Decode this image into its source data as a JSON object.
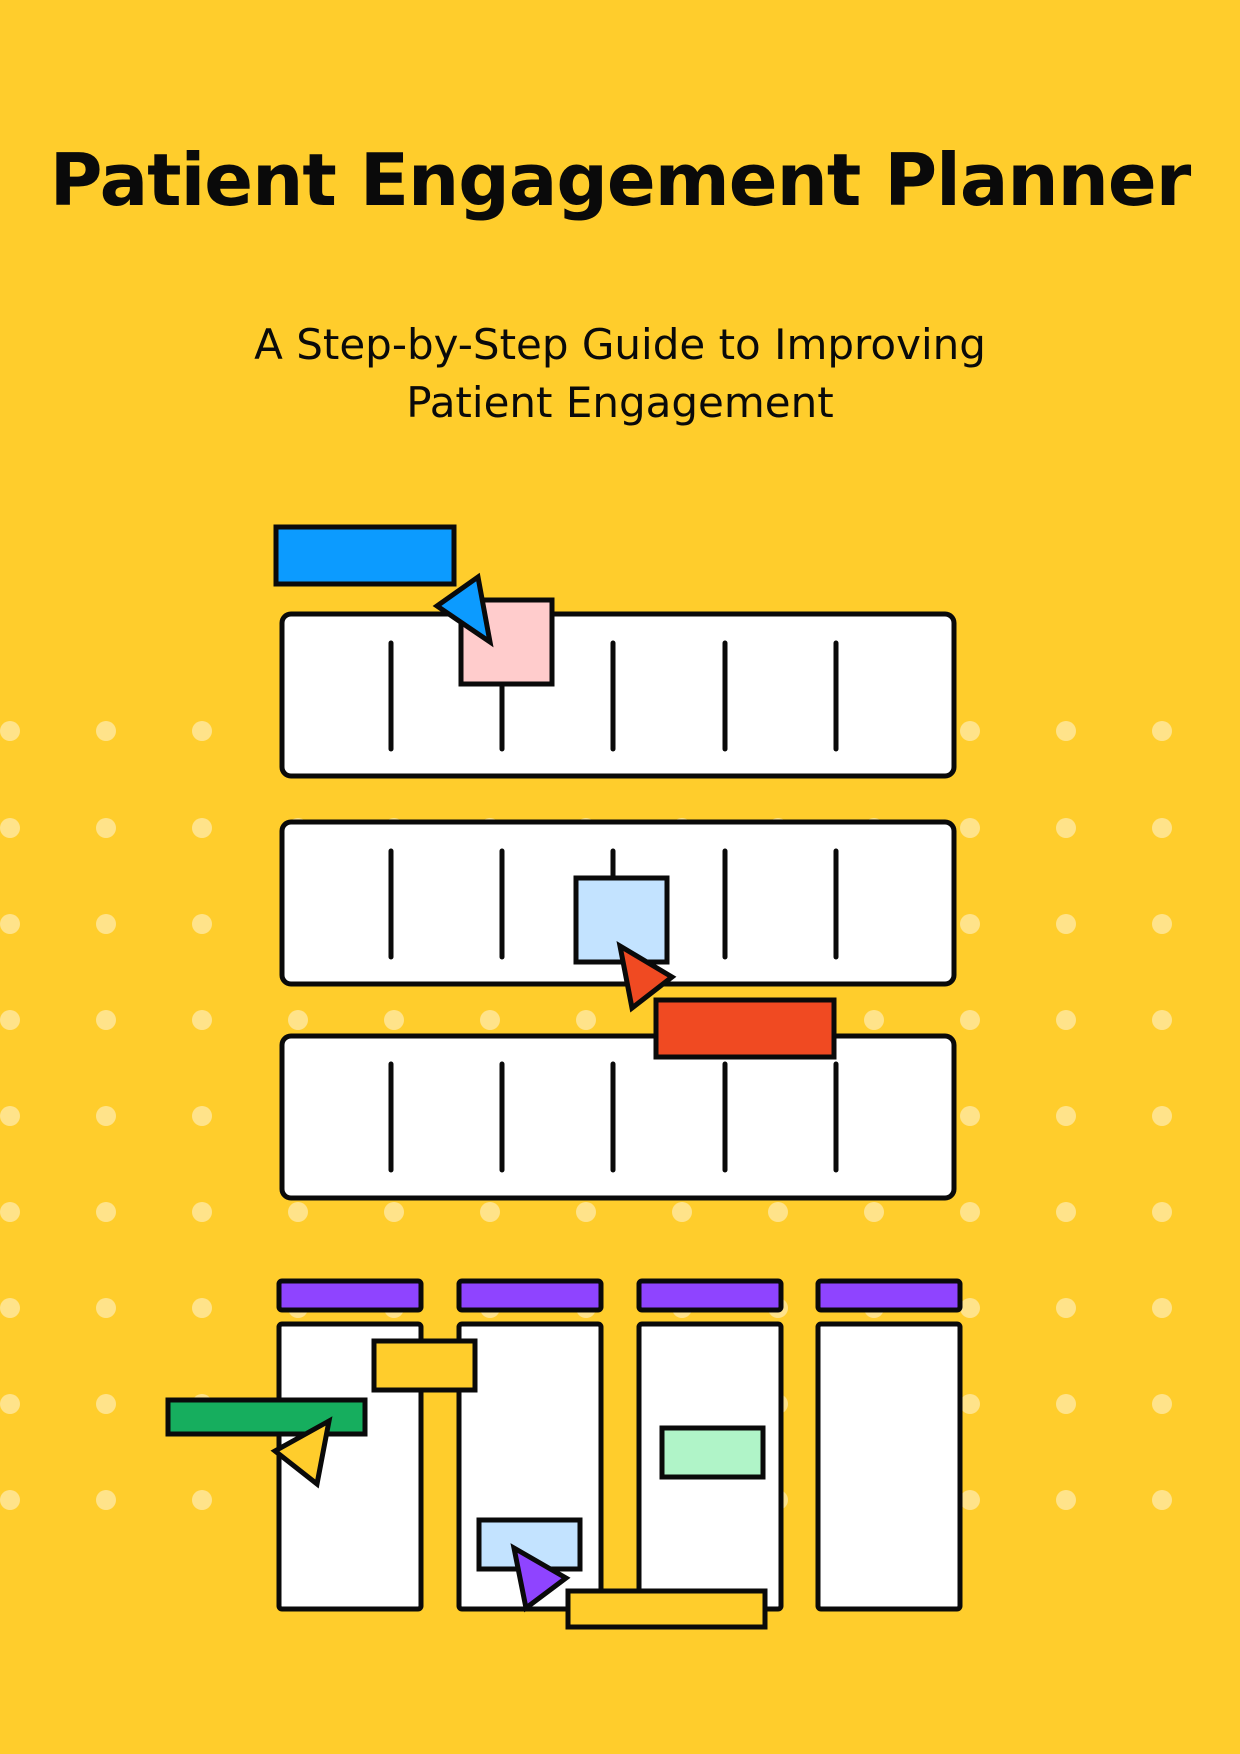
{
  "page": {
    "background_color": "#FFCD2C",
    "title": "Patient Engagement Planner",
    "subtitle_lines": [
      "A Step-by-Step Guide to Improving",
      "Patient Engagement"
    ]
  },
  "illustration": {
    "description": "",
    "colors": {
      "stroke": "#0A0A0A",
      "panel_fill": "#FFFFFF",
      "dots": "#FFE38A",
      "blue": "#0C9BFF",
      "pink": "#FFCCCC",
      "light_blue": "#C3E3FF",
      "red_orange": "#F04A22",
      "purple": "#8F44FF",
      "green": "#16AE5E",
      "mint": "#B0F4C8",
      "yellow": "#FFCD2C"
    },
    "icons": [
      "blue-cursor-icon",
      "red-cursor-icon",
      "yellow-cursor-icon",
      "purple-cursor-icon"
    ]
  }
}
